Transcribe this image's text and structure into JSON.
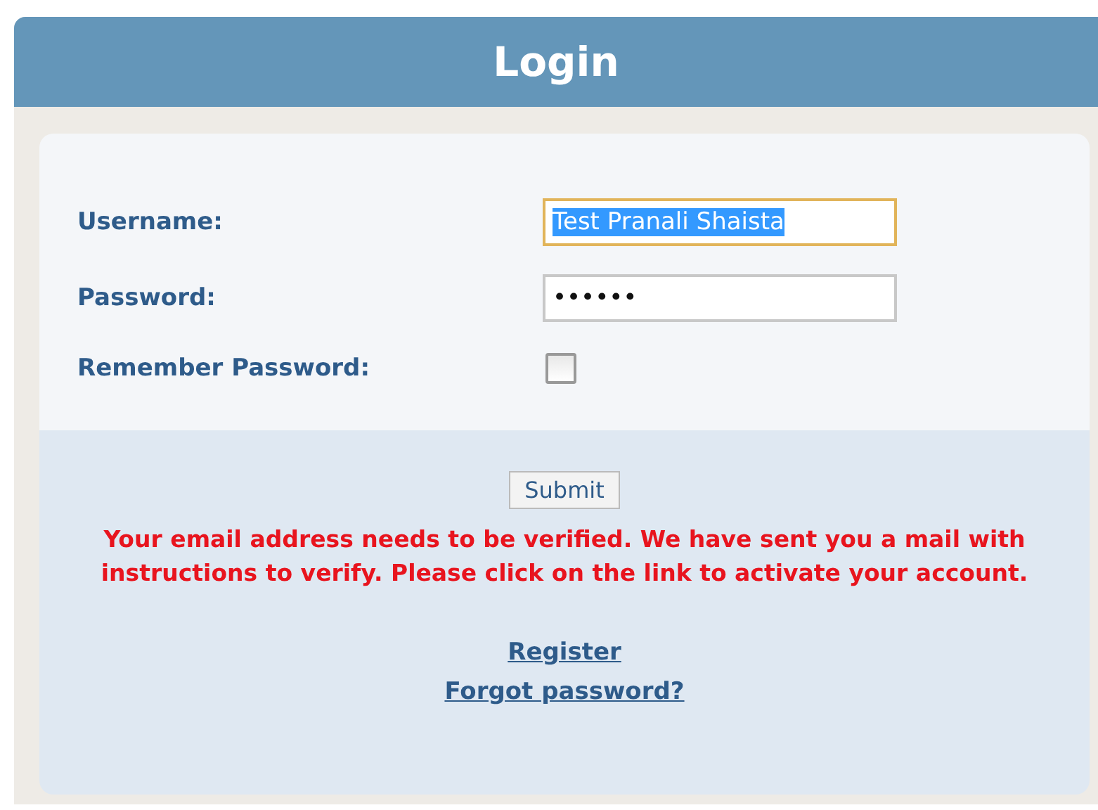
{
  "header": {
    "title": "Login"
  },
  "fields": [
    {
      "kind": "text",
      "label": "Username:",
      "value": "Test Pranali Shaista",
      "focused": true
    },
    {
      "kind": "password",
      "label": "Password:",
      "value": "••••••",
      "focused": false
    },
    {
      "kind": "checkbox",
      "label": "Remember Password:",
      "checked": false
    }
  ],
  "submit": "Submit",
  "error": "Your email address needs to be verified. We have sent you a mail with instructions to verify. Please click on the link to activate your account.",
  "links": [
    "Register",
    "Forgot password?"
  ]
}
